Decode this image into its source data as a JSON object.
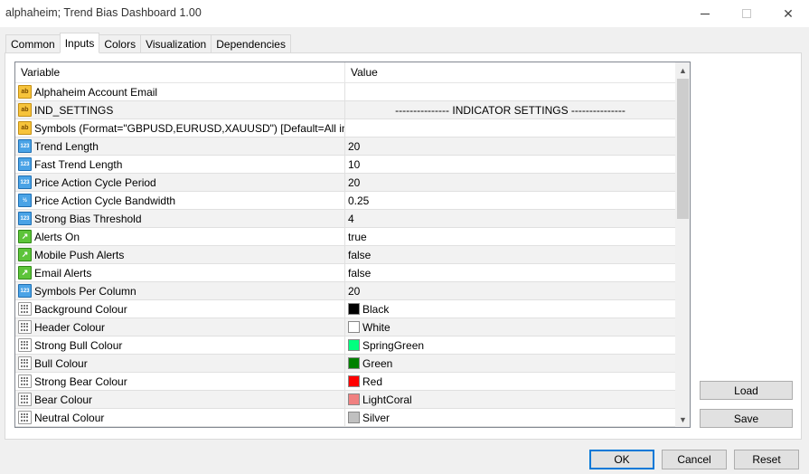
{
  "window": {
    "title": "alphaheim; Trend Bias Dashboard 1.00",
    "close_glyph": "✕"
  },
  "tabs": [
    {
      "label": "Common",
      "active": false
    },
    {
      "label": "Inputs",
      "active": true
    },
    {
      "label": "Colors",
      "active": false
    },
    {
      "label": "Visualization",
      "active": false
    },
    {
      "label": "Dependencies",
      "active": false
    }
  ],
  "grid": {
    "headers": {
      "variable": "Variable",
      "value": "Value"
    },
    "rows": [
      {
        "icon": "ab",
        "variable": "Alphaheim Account Email",
        "value": ""
      },
      {
        "icon": "ab",
        "variable": "IND_SETTINGS",
        "value": "--------------- INDICATOR SETTINGS ---------------",
        "center": true
      },
      {
        "icon": "ab",
        "variable": "Symbols (Format=\"GBPUSD,EURUSD,XAUUSD\") [Default=All in Market",
        "value": ""
      },
      {
        "icon": "num",
        "variable": "Trend Length",
        "value": "20"
      },
      {
        "icon": "num",
        "variable": "Fast Trend Length",
        "value": "10"
      },
      {
        "icon": "num",
        "variable": "Price Action Cycle Period",
        "value": "20"
      },
      {
        "icon": "frac",
        "variable": "Price Action Cycle Bandwidth",
        "value": "0.25"
      },
      {
        "icon": "num",
        "variable": "Strong Bias Threshold",
        "value": "4"
      },
      {
        "icon": "bool",
        "variable": "Alerts On",
        "value": "true"
      },
      {
        "icon": "bool",
        "variable": "Mobile Push Alerts",
        "value": "false"
      },
      {
        "icon": "bool",
        "variable": "Email Alerts",
        "value": "false"
      },
      {
        "icon": "num",
        "variable": "Symbols Per Column",
        "value": "20"
      },
      {
        "icon": "color",
        "variable": "Background Colour",
        "value": "Black",
        "swatch": "#000000"
      },
      {
        "icon": "color",
        "variable": "Header Colour",
        "value": "White",
        "swatch": "#ffffff"
      },
      {
        "icon": "color",
        "variable": "Strong Bull Colour",
        "value": "SpringGreen",
        "swatch": "#00ff7f"
      },
      {
        "icon": "color",
        "variable": "Bull Colour",
        "value": "Green",
        "swatch": "#008000"
      },
      {
        "icon": "color",
        "variable": "Strong Bear Colour",
        "value": "Red",
        "swatch": "#ff0000"
      },
      {
        "icon": "color",
        "variable": "Bear Colour",
        "value": "LightCoral",
        "swatch": "#f08080"
      },
      {
        "icon": "color",
        "variable": "Neutral Colour",
        "value": "Silver",
        "swatch": "#c0c0c0"
      }
    ]
  },
  "icons": {
    "ab": {
      "name": "string-type-icon",
      "text": "ab"
    },
    "num": {
      "name": "integer-type-icon",
      "text": "123"
    },
    "frac": {
      "name": "double-type-icon",
      "text": "½"
    },
    "bool": {
      "name": "bool-type-icon",
      "text": "↗"
    },
    "color": {
      "name": "color-type-icon",
      "text": ""
    }
  },
  "buttons": {
    "load": "Load",
    "save": "Save",
    "ok": "OK",
    "cancel": "Cancel",
    "reset": "Reset"
  },
  "scrollbar": {
    "up": "▲",
    "down": "▼"
  }
}
